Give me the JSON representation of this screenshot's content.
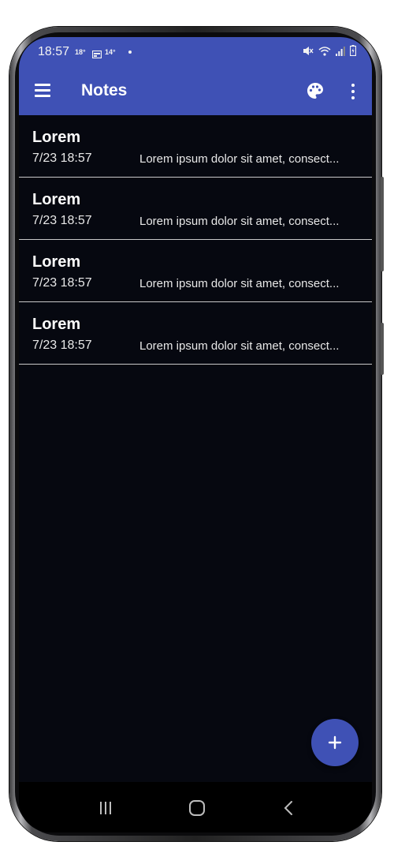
{
  "status_bar": {
    "time": "18:57",
    "temp_1": "18°",
    "temp_2": "14°",
    "icons": [
      "calendar-icon",
      "dot-icon",
      "mute-icon",
      "wifi-icon",
      "signal-icon",
      "battery-icon"
    ]
  },
  "app_bar": {
    "title": "Notes",
    "background_color": "#3f51b5",
    "icons": [
      "menu-icon",
      "palette-icon",
      "more-vert-icon"
    ]
  },
  "notes": [
    {
      "title": "Lorem",
      "date": "7/23 18:57",
      "preview": "Lorem ipsum dolor sit amet, consect..."
    },
    {
      "title": "Lorem",
      "date": "7/23 18:57",
      "preview": "Lorem ipsum dolor sit amet, consect..."
    },
    {
      "title": "Lorem",
      "date": "7/23 18:57",
      "preview": "Lorem ipsum dolor sit amet, consect..."
    },
    {
      "title": "Lorem",
      "date": "7/23 18:57",
      "preview": "Lorem ipsum dolor sit amet, consect..."
    }
  ],
  "fab": {
    "icon": "plus-icon",
    "color": "#3f51b5"
  },
  "nav_bar": {
    "icons": [
      "recent-apps-icon",
      "home-icon",
      "back-icon"
    ]
  },
  "colors": {
    "screen_background": "#060810",
    "accent": "#3f51b5",
    "divider": "#c9c9c9"
  }
}
